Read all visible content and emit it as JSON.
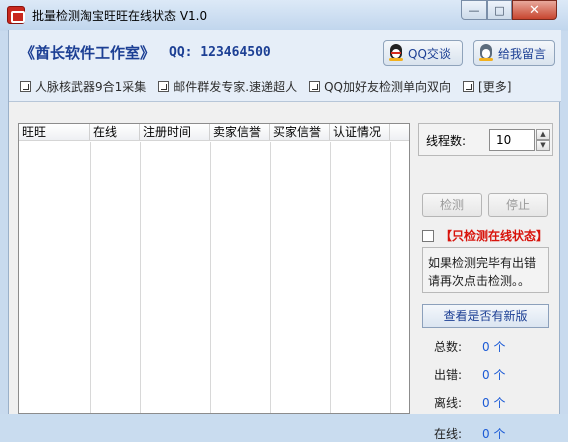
{
  "window": {
    "title": "批量检测淘宝旺旺在线状态 V1.0",
    "min_glyph": "—",
    "max_glyph": "□",
    "close_glyph": "✕"
  },
  "header": {
    "brand": "《酋长软件工作室》",
    "qq": "QQ: 123464500",
    "qq_chat_label": "QQ交谈",
    "leave_message_label": "给我留言",
    "links": [
      "人脉核武器9合1采集",
      "邮件群发专家.速递超人",
      "QQ加好友检测单向双向",
      "[更多]"
    ]
  },
  "table": {
    "columns": [
      "旺旺",
      "在线",
      "注册时间",
      "卖家信誉",
      "买家信誉",
      "认证情况"
    ]
  },
  "right_panel": {
    "thread_label": "线程数:",
    "thread_value": "10",
    "check_button": "检测",
    "stop_button": "停止",
    "online_only_label": "【只检测在线状态】",
    "online_only_checked": false,
    "hint_line1": "如果检测完毕有出错",
    "hint_line2": "请再次点击检测。。",
    "new_version_button": "查看是否有新版",
    "stats": [
      {
        "label": "总数:",
        "value": "0 个"
      },
      {
        "label": "出错:",
        "value": "0 个"
      },
      {
        "label": "离线:",
        "value": "0 个"
      },
      {
        "label": "在线:",
        "value": "0 个"
      }
    ]
  },
  "colors": {
    "accent": "#1c3f94",
    "warning_red": "#d8130b",
    "stat_value": "#1c5bd6"
  },
  "icons": {
    "app": "app-logo-icon",
    "qq": "qq-penguin-icon",
    "message": "user-icon",
    "link": "arrow-link-icon"
  }
}
